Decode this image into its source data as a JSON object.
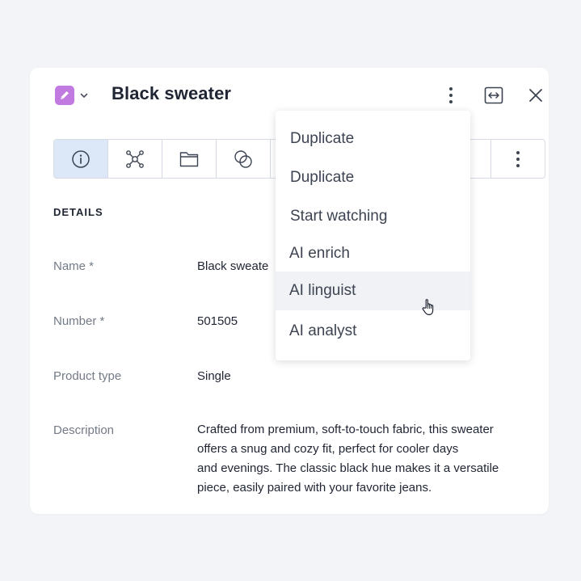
{
  "header": {
    "title": "Black sweater",
    "badge_color": "#c17be0",
    "icons": [
      "pencil-icon",
      "chevron-down-icon",
      "vertical-dots-icon",
      "expand-horizontal-icon",
      "close-icon"
    ]
  },
  "tabs": {
    "items": [
      "info-icon",
      "network-icon",
      "folder-icon",
      "linked-circles-icon"
    ],
    "active": 0,
    "active_color": "#dce8f8"
  },
  "details": {
    "section_title": "DETAILS",
    "fields": [
      {
        "label": "Name *",
        "value": "Black sweate"
      },
      {
        "label": "Number *",
        "value": "501505"
      },
      {
        "label": "Product type",
        "value": "Single"
      },
      {
        "label": "Description",
        "lines": [
          "Crafted from premium, soft-to-touch fabric, this sweater",
          "offers a snug and cozy fit, perfect for cooler days",
          "and evenings. The classic black hue makes it a versatile",
          "piece, easily paired with your favorite jeans."
        ]
      }
    ]
  },
  "menu": {
    "items": [
      {
        "label": "Duplicate"
      },
      {
        "label": "Duplicate"
      },
      {
        "label": "Start watching"
      },
      {
        "label": "AI enrich"
      },
      {
        "label": "AI linguist",
        "hovered": true
      },
      {
        "label": "AI analyst"
      }
    ],
    "hover_color": "#f1f2f6"
  }
}
